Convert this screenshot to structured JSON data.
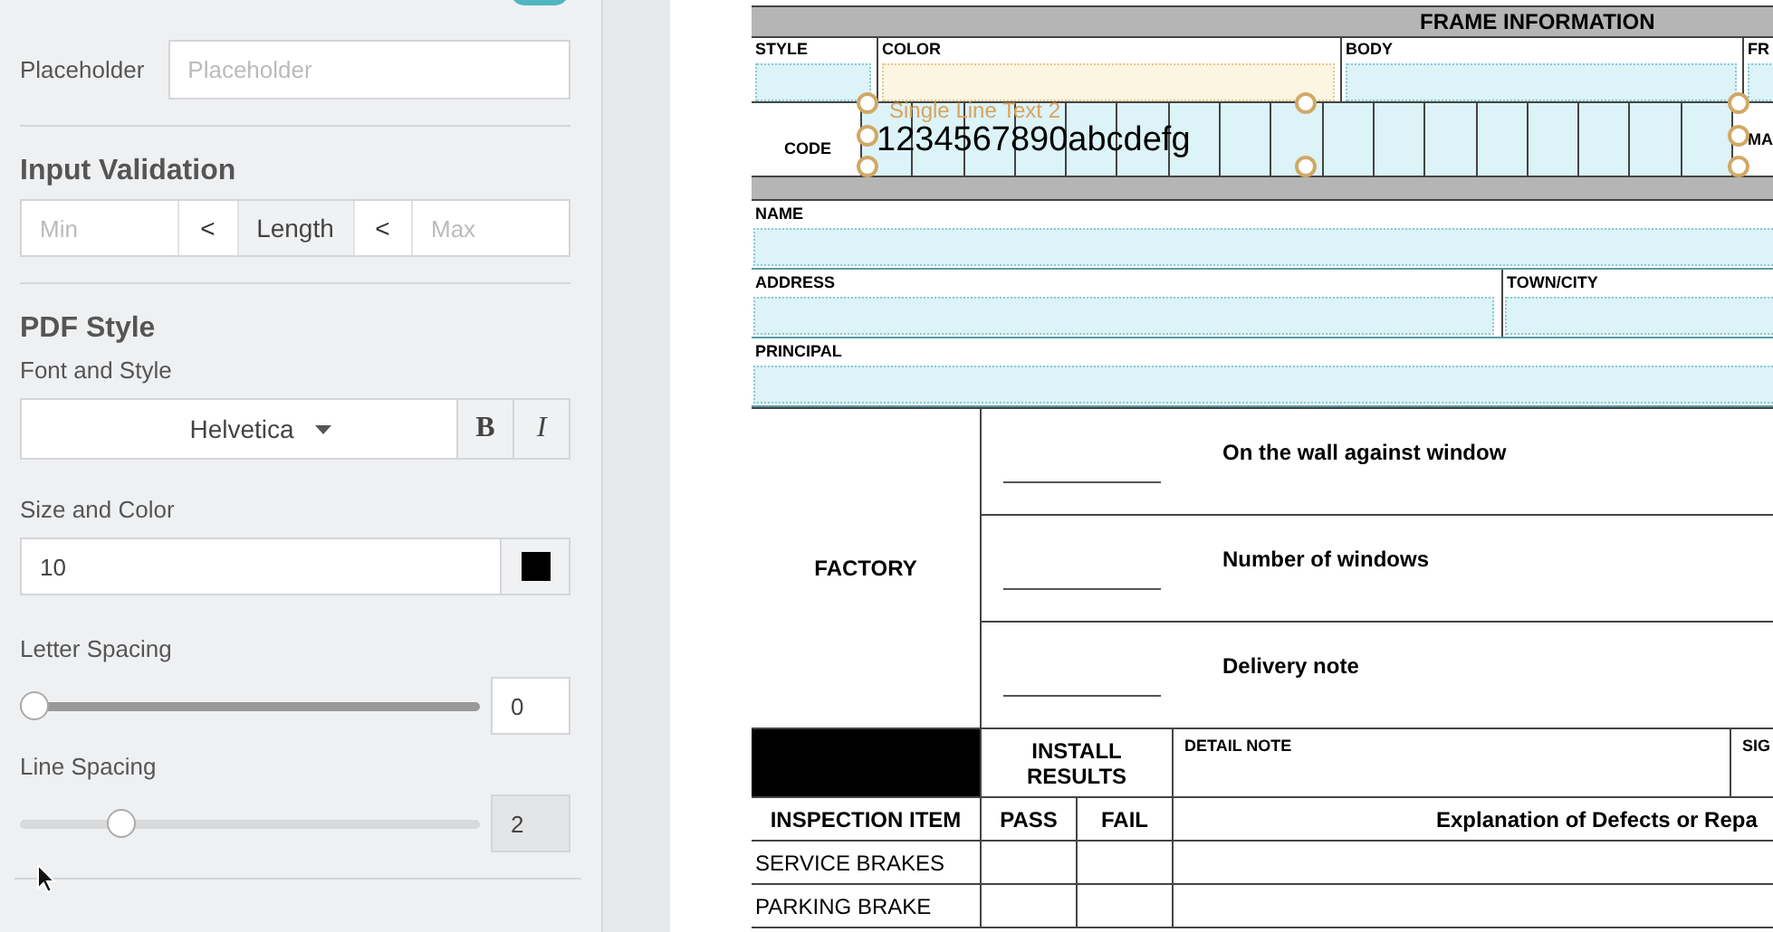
{
  "sidebar": {
    "toggle": {
      "on": true
    },
    "placeholder_row": {
      "label": "Placeholder",
      "placeholder": "Placeholder"
    },
    "input_validation": {
      "title": "Input Validation",
      "min": {
        "placeholder": "Min"
      },
      "operators": [
        "<",
        "<"
      ],
      "middle": "Length",
      "max": {
        "placeholder": "Max"
      }
    },
    "pdf_style": {
      "title": "PDF Style",
      "font_label": "Font and Style",
      "font": "Helvetica",
      "style_buttons": [
        {
          "label": "B",
          "kind": "bold"
        },
        {
          "label": "I",
          "kind": "italic"
        }
      ],
      "size_label": "Size and Color",
      "size": "10",
      "color": "#000000",
      "sliders": [
        {
          "label": "Letter Spacing",
          "level": 0,
          "value": "0",
          "disabled": false
        },
        {
          "label": "Line Spacing",
          "level": 0.2,
          "value": "2",
          "disabled": true
        }
      ]
    }
  },
  "document": {
    "title": "FRAME INFORMATION",
    "top_fields": [
      {
        "label": "STYLE",
        "highlighted": false
      },
      {
        "label": "COLOR",
        "highlighted": true
      },
      {
        "label": "BODY",
        "highlighted": false
      },
      {
        "label": "FR",
        "highlighted": false
      }
    ],
    "code": {
      "label": "CODE",
      "field_name": "Single Line Text 2",
      "value": "1234567890abcdefg",
      "selected": true,
      "next_label": "MA"
    },
    "field_rows": [
      [
        {
          "label": "NAME"
        }
      ],
      [
        {
          "label": "ADDRESS"
        },
        {
          "label": "TOWN/CITY"
        }
      ],
      [
        {
          "label": "PRINCIPAL"
        }
      ]
    ],
    "factory": {
      "label": "FACTORY",
      "items": [
        "On the wall against window",
        "Number of windows",
        "Delivery note"
      ]
    },
    "inspection": {
      "group_header": "INSTALL RESULTS",
      "detail_header": "DETAIL NOTE",
      "sign_header": "SIG",
      "columns": [
        "INSPECTION ITEM",
        "PASS",
        "FAIL",
        "Explanation of Defects or Repa"
      ],
      "rows": [
        "SERVICE BRAKES",
        "PARKING BRAKE"
      ]
    }
  }
}
